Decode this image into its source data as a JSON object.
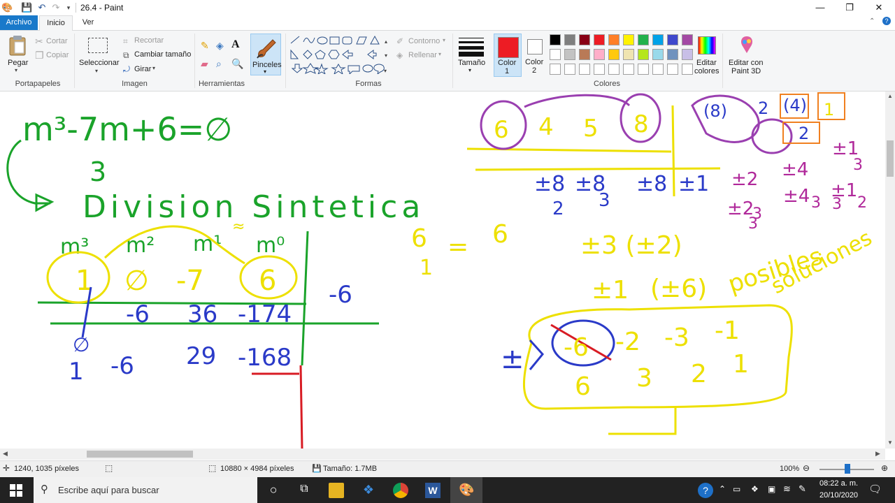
{
  "window": {
    "title": "26.4 - Paint",
    "minimize_glyph": "—",
    "maximize_glyph": "❐",
    "close_glyph": "✕"
  },
  "menu": {
    "tabs": [
      {
        "label": "Archivo"
      },
      {
        "label": "Inicio"
      },
      {
        "label": "Ver"
      }
    ]
  },
  "ribbon": {
    "clipboard": {
      "paste_label": "Pegar",
      "cut_label": "Cortar",
      "copy_label": "Copiar",
      "group_label": "Portapapeles"
    },
    "image": {
      "select_label": "Seleccionar",
      "crop_label": "Recortar",
      "resize_label": "Cambiar tamaño",
      "rotate_label": "Girar",
      "group_label": "Imagen"
    },
    "tools": {
      "group_label": "Herramientas",
      "text_glyph": "A"
    },
    "brushes": {
      "label": "Pinceles"
    },
    "shapes": {
      "outline_label": "Contorno",
      "fill_label": "Rellenar",
      "group_label": "Formas"
    },
    "size": {
      "label": "Tamaño"
    },
    "color1": {
      "label_line1": "Color",
      "label_line2": "1",
      "value": "#ed1c24"
    },
    "color2": {
      "label_line1": "Color",
      "label_line2": "2",
      "value": "#ffffff"
    },
    "colors": {
      "group_label": "Colores",
      "row1": [
        "#000000",
        "#7f7f7f",
        "#880015",
        "#ed1c24",
        "#ff7f27",
        "#fff200",
        "#22b14c",
        "#00a2e8",
        "#3f48cc",
        "#a349a4"
      ],
      "row2": [
        "#ffffff",
        "#c3c3c3",
        "#b97a57",
        "#ffaec9",
        "#ffc90e",
        "#efe4b0",
        "#b5e61d",
        "#99d9ea",
        "#7092be",
        "#c8bfe7"
      ],
      "row3": [
        "#ffffff",
        "#ffffff",
        "#ffffff",
        "#ffffff",
        "#ffffff",
        "#ffffff",
        "#ffffff",
        "#ffffff",
        "#ffffff",
        "#ffffff"
      ]
    },
    "edit_colors": {
      "line1": "Editar",
      "line2": "colores"
    },
    "paint3d": {
      "line1": "Editar con",
      "line2": "Paint 3D"
    }
  },
  "drawing": {
    "green": {
      "equation": "m³-7m+6=∅",
      "arrow_label": "3",
      "title": "Division Sintetica",
      "headers": [
        "m³",
        "m²",
        "m¹",
        "m⁰"
      ],
      "approx": "≈"
    },
    "yellow_row": [
      "1",
      "∅",
      "-7",
      "6"
    ],
    "blue_row1": [
      "-6",
      "36",
      "-174"
    ],
    "blue_row2": [
      "1",
      "-6",
      "29",
      "-168"
    ],
    "blue_side": "∅",
    "divisor": "-6",
    "right_top": {
      "nums": [
        "6",
        "4",
        "5",
        "8"
      ],
      "blue_list": [
        "±8",
        "±8",
        "±8",
        "±1"
      ],
      "blue_den": [
        "2",
        "3"
      ]
    },
    "right_purple": {
      "text": [
        "±2",
        "±4",
        "±1",
        "±2",
        "±4",
        "±1"
      ],
      "dens": [
        "3",
        "3",
        "3",
        "2",
        "3",
        "3"
      ],
      "boxes": [
        "(8)",
        "2",
        "(4)",
        "1",
        "2"
      ]
    },
    "right_yellow": {
      "fraction": "6",
      "den": "1",
      "eq": "=",
      "six": "6",
      "line2": "±3 (±2)",
      "line3": "±1",
      "paren": "(±6)",
      "word1": "posibles",
      "word2": "soluciones",
      "box_row1": [
        "-6",
        "-2",
        "-3",
        "-1"
      ],
      "box_row2": [
        "6",
        "3",
        "2",
        "1"
      ]
    },
    "blue_pm": "±"
  },
  "status": {
    "cursor_pos": "1240, 1035 píxeles",
    "dimensions": "10880 × 4984 píxeles",
    "size": "Tamaño: 1.7MB",
    "zoom": "100%"
  },
  "taskbar": {
    "search_placeholder": "Escribe aquí para buscar",
    "time": "08:22 a. m.",
    "date": "20/10/2020"
  }
}
